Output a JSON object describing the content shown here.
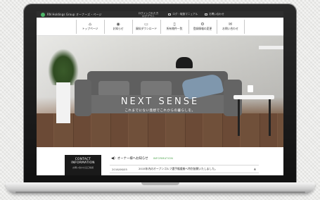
{
  "topbar": {
    "brand": "RN Holdings Group オーナーズ・ページ",
    "member_line1": "ログインされた方",
    "member_line2": "ログアウト",
    "manual": "ログ・取扱マニュアル",
    "contact": "お問い合わせ"
  },
  "nav": {
    "items": [
      {
        "label": "トップページ",
        "icon": "home-icon"
      },
      {
        "label": "お知らせ",
        "icon": "bell-icon"
      },
      {
        "label": "資料ダウンロード",
        "icon": "folder-icon"
      },
      {
        "label": "所有物件一覧",
        "icon": "document-icon"
      },
      {
        "label": "登録情報の変更",
        "icon": "gear-icon"
      },
      {
        "label": "お問い合わせ",
        "icon": "mail-icon"
      }
    ]
  },
  "hero": {
    "title": "NEXT SENSE",
    "subtitle": "これまでにない発想でこれからの暮らしを。"
  },
  "contact_box": {
    "line1": "CONTACT",
    "line2": "INFORMATION",
    "line3": "お問い合わせ窓口情報"
  },
  "info": {
    "heading": "オーナー様へお知らせ",
    "tag": "INFORMATION",
    "news": [
      {
        "date": "2016/06/05",
        "text": "2015年内のオープンゴルフ選手権優勝へ特別協賛いたしました。"
      }
    ]
  },
  "colors": {
    "accent_green": "#4aa24a",
    "topbar_bg": "#2e2e2e",
    "contact_bg": "#1a1a1a"
  }
}
